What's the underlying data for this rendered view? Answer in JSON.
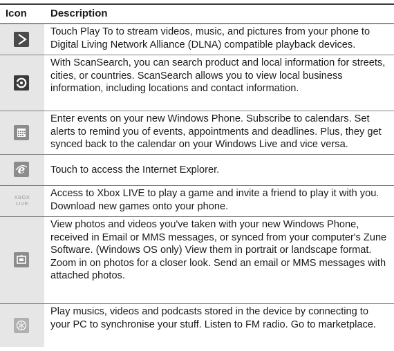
{
  "table": {
    "header": {
      "icon": "Icon",
      "description": "Description"
    },
    "rows": [
      {
        "icon": "play-to-icon",
        "description": "Touch Play To to stream videos, music, and pictures from your phone to Digital Living Network Alliance (DLNA) compatible playback devices."
      },
      {
        "icon": "scansearch-icon",
        "description": "With ScanSearch, you can search product and local information for streets, cities, or countries. ScanSearch allows you to view local business information, including locations and contact information."
      },
      {
        "icon": "calendar-icon",
        "description": "Enter events on your new Windows Phone. Subscribe to calendars. Set alerts to remind you of events, appointments and deadlines. Plus, they get synced back to the calendar on your Windows Live and vice versa."
      },
      {
        "icon": "internet-explorer-icon",
        "description": "Touch to access the Internet Explorer."
      },
      {
        "icon": "xbox-live-icon",
        "icon_text": "XBOX LIVE",
        "description": "Access to Xbox LIVE to play a game and invite a friend to play it with you. Download new games onto your phone."
      },
      {
        "icon": "pictures-icon",
        "description": "View photos and videos you've taken with your new Windows Phone, received in Email or MMS messages, or synced from your computer's Zune Software. (Windows OS only) View them in portrait or landscape format. Zoom in on photos for a closer look. Send an email or MMS messages with attached photos."
      },
      {
        "icon": "zune-music-icon",
        "description": "Play musics, videos and podcasts stored in the device by connecting to your PC to synchronise your stuff. Listen to FM radio. Go to marketplace."
      }
    ]
  }
}
